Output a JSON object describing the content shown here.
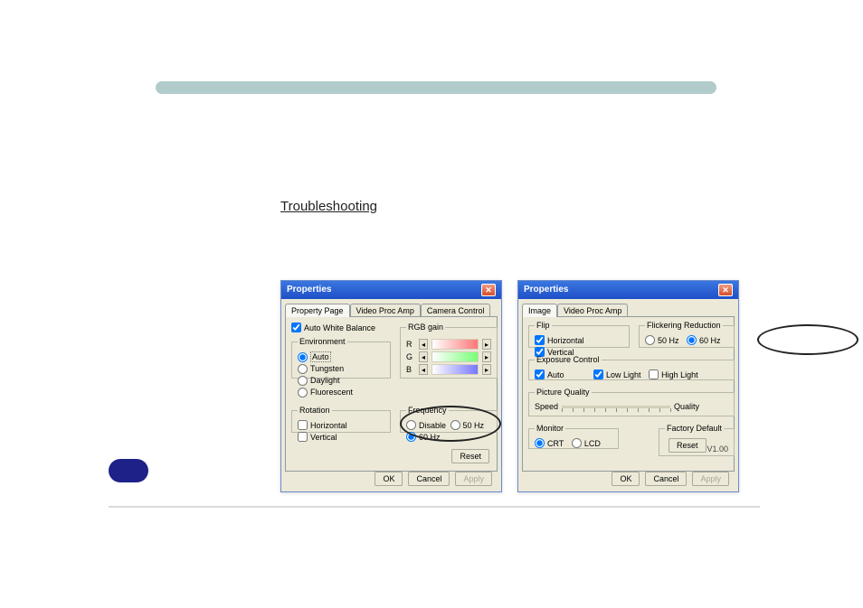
{
  "troubleshoot_label": "Troubleshooting",
  "dialog_title": "Properties",
  "tabs": {
    "property_page": "Property Page",
    "video_proc_amp": "Video Proc Amp",
    "camera_control": "Camera Control",
    "image": "Image"
  },
  "d1": {
    "awb": "Auto White Balance",
    "env_legend": "Environment",
    "env_auto": "Auto",
    "env_tungsten": "Tungsten",
    "env_daylight": "Daylight",
    "env_fluorescent": "Fluorescent",
    "rgb_legend": "RGB gain",
    "r": "R",
    "g": "G",
    "b": "B",
    "rotation_legend": "Rotation",
    "horiz": "Horizontal",
    "vert": "Vertical",
    "freq_legend": "Frequency",
    "f_disable": "Disable",
    "f_50": "50 Hz",
    "f_60": "60 Hz",
    "reset": "Reset"
  },
  "d2": {
    "flip_legend": "Flip",
    "horiz": "Horizontal",
    "vert": "Vertical",
    "flicker_legend": "Flickering Reduction",
    "f_50": "50 Hz",
    "f_60": "60 Hz",
    "exposure_legend": "Exposure Control",
    "auto": "Auto",
    "low": "Low Light",
    "high": "High Light",
    "pq_legend": "Picture Quality",
    "speed": "Speed",
    "quality": "Quality",
    "monitor_legend": "Monitor",
    "crt": "CRT",
    "lcd": "LCD",
    "fd_legend": "Factory Default",
    "reset": "Reset",
    "version": "V1.00"
  },
  "buttons": {
    "ok": "OK",
    "cancel": "Cancel",
    "apply": "Apply"
  }
}
